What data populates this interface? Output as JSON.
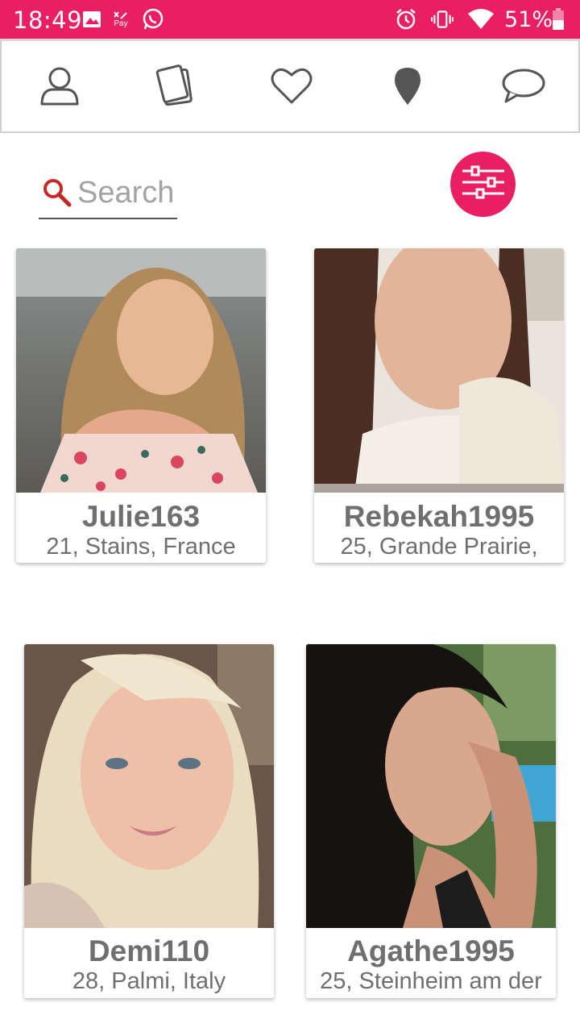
{
  "status_bar": {
    "time": "18:49",
    "battery": "51%",
    "icons": [
      "image-icon",
      "pay-icon",
      "whatsapp-icon",
      "alarm-icon",
      "vibrate-icon",
      "wifi-icon",
      "battery-icon"
    ],
    "pay_label": "Pay"
  },
  "nav": {
    "items": [
      {
        "icon": "profile-icon"
      },
      {
        "icon": "cards-icon"
      },
      {
        "icon": "heart-icon"
      },
      {
        "icon": "location-pin-icon"
      },
      {
        "icon": "chat-bubble-icon"
      }
    ]
  },
  "search": {
    "placeholder": "Search",
    "value": ""
  },
  "filter": {
    "icon": "sliders-icon"
  },
  "colors": {
    "accent": "#e91e63",
    "text_gray": "#6f6f6f",
    "search_icon": "#c62828"
  },
  "profiles": [
    {
      "name": "Julie163",
      "info": "21, Stains, France"
    },
    {
      "name": "Rebekah1995",
      "info": "25, Grande Prairie,"
    },
    {
      "name": "Demi110",
      "info": "28, Palmi, Italy"
    },
    {
      "name": "Agathe1995",
      "info": "25, Steinheim am der"
    }
  ]
}
